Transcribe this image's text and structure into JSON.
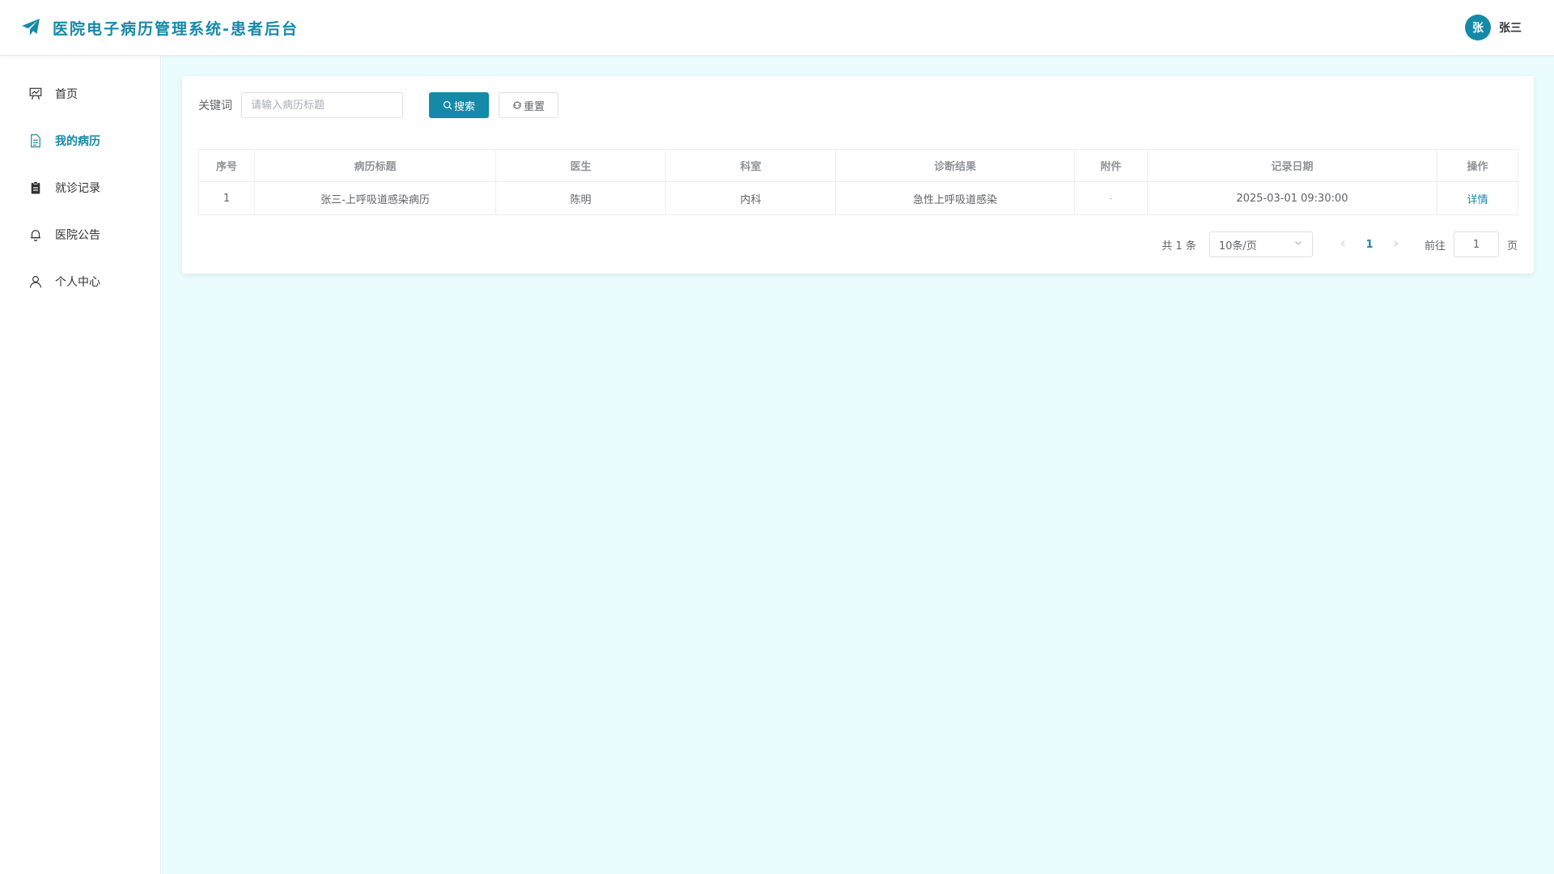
{
  "header": {
    "title": "医院电子病历管理系统-患者后台",
    "user": {
      "avatar_text": "张",
      "name": "张三"
    }
  },
  "sidebar": {
    "items": [
      {
        "label": "首页",
        "icon": "presentation-board-icon",
        "active": false
      },
      {
        "label": "我的病历",
        "icon": "document-icon",
        "active": true
      },
      {
        "label": "就诊记录",
        "icon": "clipboard-icon",
        "active": false
      },
      {
        "label": "医院公告",
        "icon": "bell-icon",
        "active": false
      },
      {
        "label": "个人中心",
        "icon": "user-icon",
        "active": false
      }
    ]
  },
  "search": {
    "label": "关键词",
    "placeholder": "请输入病历标题",
    "value": "",
    "search_button": "搜索",
    "reset_button": "重置"
  },
  "table": {
    "columns": [
      "序号",
      "病历标题",
      "医生",
      "科室",
      "诊断结果",
      "附件",
      "记录日期",
      "操作"
    ],
    "rows": [
      {
        "index": "1",
        "title": "张三-上呼吸道感染病历",
        "doctor": "陈明",
        "department": "内科",
        "diagnosis": "急性上呼吸道感染",
        "attachment": "-",
        "date": "2025-03-01 09:30:00",
        "action": "详情"
      }
    ]
  },
  "pagination": {
    "total_text": "共 1 条",
    "page_size": "10条/页",
    "current_page": "1",
    "goto_label": "前往",
    "goto_value": "1",
    "page_suffix": "页"
  },
  "colors": {
    "primary": "#1589a8",
    "main_bg": "#eafcfe"
  }
}
